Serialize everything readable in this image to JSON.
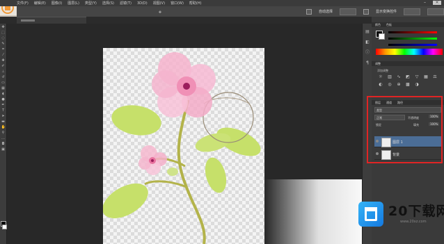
{
  "menubar": {
    "items": [
      "文件(F)",
      "编辑(E)",
      "图像(I)",
      "图层(L)",
      "类型(Y)",
      "选择(S)",
      "滤镜(T)",
      "3D(D)",
      "视图(V)",
      "窗口(W)",
      "帮助(H)"
    ]
  },
  "options_bar": {
    "auto_select_label": "自动选择",
    "transform_label": "显示变换控件"
  },
  "panels": {
    "color_tab": "颜色",
    "swatches_tab": "色板",
    "adjustments_tab": "调整",
    "adjustments_subtitle": "添加调整",
    "layers_tab": "图层",
    "channels_tab": "通道",
    "paths_tab": "路径",
    "kind_filter": "类型",
    "blend_mode": "正常",
    "opacity_label": "不透明度",
    "opacity_value": "100%",
    "lock_label": "锁定",
    "fill_label": "填充",
    "fill_value": "100%"
  },
  "layers": [
    {
      "name": "图层 1",
      "active": true
    },
    {
      "name": "背景",
      "active": false
    }
  ],
  "watermark": {
    "brand": "20下载网",
    "url": "www.20xz.com"
  },
  "colors": {
    "highlight_box": "#e02424",
    "active_layer": "#4b6d96",
    "flower_pink": "#f5a8c9",
    "leaf_green": "#c6e06a"
  }
}
